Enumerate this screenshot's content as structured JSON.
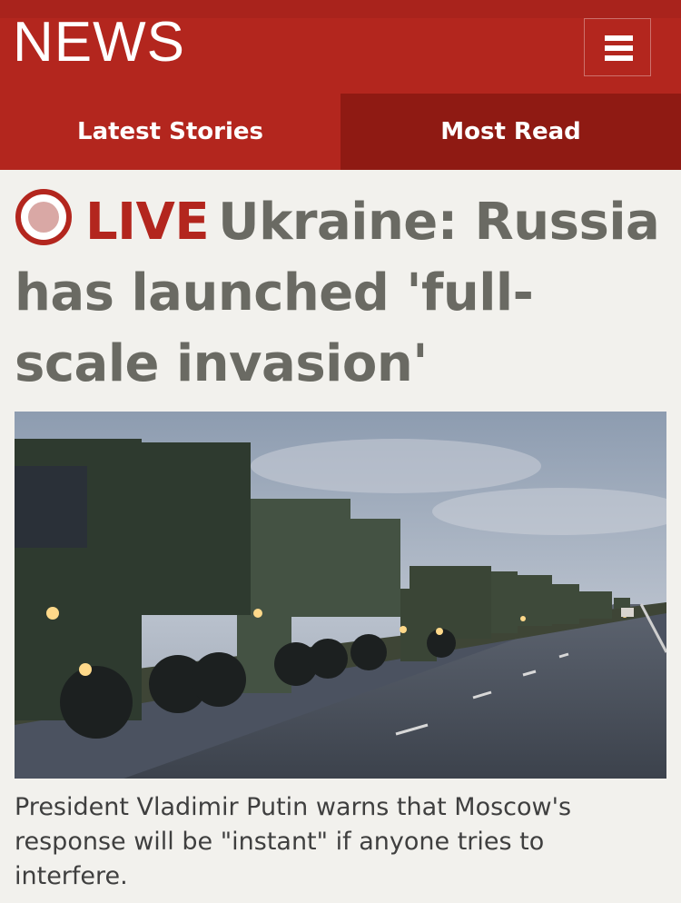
{
  "header": {
    "logo": "NEWS",
    "menu_icon": "hamburger-menu-icon",
    "brand_color": "#b3261e",
    "tabs": [
      {
        "label": "Latest Stories",
        "active": true
      },
      {
        "label": "Most Read",
        "active": false
      }
    ]
  },
  "article": {
    "live_icon": "live-radio-icon",
    "live_label": "LIVE",
    "title": "Ukraine: Russia has launched 'full-scale invasion'",
    "image_subject": "Convoy of military trucks on a road",
    "caption": "President Vladimir Putin warns that Moscow's response will be \"instant\" if anyone tries to interfere."
  }
}
